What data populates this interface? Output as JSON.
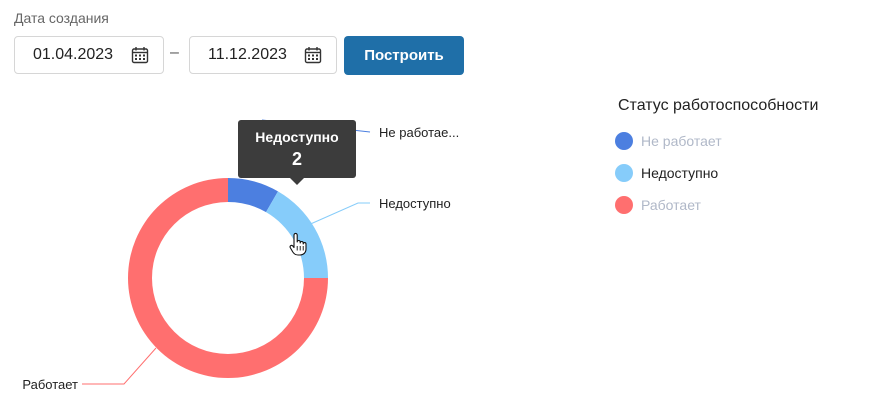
{
  "filter": {
    "label": "Дата создания",
    "date_from": "01.04.2023",
    "separator": "–",
    "date_to": "11.12.2023",
    "build_button": "Построить"
  },
  "legend": {
    "title": "Статус работоспособности",
    "items": [
      {
        "label": "Не работает",
        "color": "#4c7fe0",
        "dimmed": true
      },
      {
        "label": "Недоступно",
        "color": "#86ccfa",
        "dimmed": false
      },
      {
        "label": "Работает",
        "color": "#ff6f6f",
        "dimmed": true
      }
    ]
  },
  "tooltip": {
    "title": "Недоступно",
    "value": "2"
  },
  "chart_data": {
    "type": "pie",
    "donut": true,
    "slices": [
      {
        "label": "Не работает",
        "value": 1,
        "color": "#4c7fe0",
        "label_text": "Не работае..."
      },
      {
        "label": "Недоступно",
        "value": 2,
        "color": "#86ccfa",
        "label_text": "Недоступно"
      },
      {
        "label": "Работает",
        "value": 9,
        "color": "#ff6f6f",
        "label_text": "Работает"
      }
    ]
  }
}
